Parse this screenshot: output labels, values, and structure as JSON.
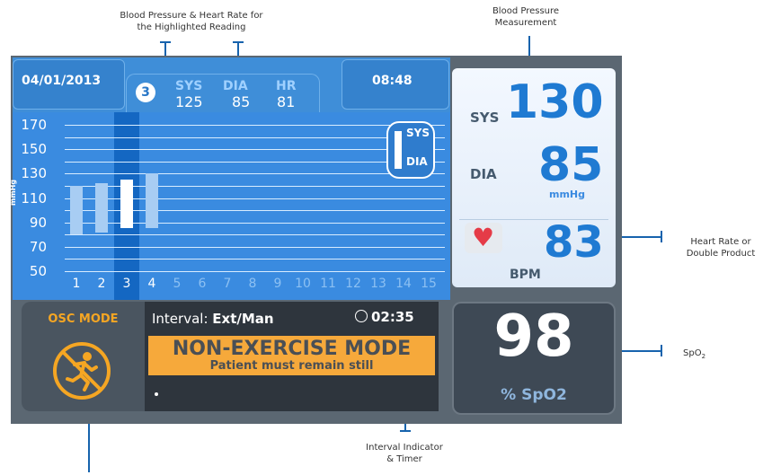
{
  "annotations": {
    "top_left_line1": "Blood Pressure & Heart Rate for",
    "top_left_line2": "the Highlighted Reading",
    "top_right_line1": "Blood Pressure",
    "top_right_line2": "Measurement",
    "right_hr_line1": "Heart Rate or",
    "right_hr_line2": "Double Product",
    "right_spo2": "SpO",
    "right_spo2_sub": "2",
    "bottom_interval_line1": "Interval Indicator",
    "bottom_interval_line2": "& Timer"
  },
  "header": {
    "date": "04/01/2013",
    "reading_number": "3",
    "sys_label": "SYS",
    "sys_value": "125",
    "dia_label": "DIA",
    "dia_value": "85",
    "hr_label": "HR",
    "hr_value": "81",
    "time": "08:48"
  },
  "chart": {
    "ylabel": "mmHg",
    "legend_sys": "SYS",
    "legend_dia": "DIA",
    "highlight_index": 3
  },
  "chart_data": {
    "type": "bar",
    "categories": [
      "1",
      "2",
      "3",
      "4",
      "5",
      "6",
      "7",
      "8",
      "9",
      "10",
      "11",
      "12",
      "13",
      "14",
      "15"
    ],
    "ticks": [
      50,
      70,
      90,
      110,
      130,
      150,
      170
    ],
    "ylim": [
      50,
      170
    ],
    "ylabel": "mmHg",
    "series": [
      {
        "name": "SYS",
        "values": [
          120,
          122,
          125,
          130,
          null,
          null,
          null,
          null,
          null,
          null,
          null,
          null,
          null,
          null,
          null
        ]
      },
      {
        "name": "DIA",
        "values": [
          80,
          82,
          85,
          85,
          null,
          null,
          null,
          null,
          null,
          null,
          null,
          null,
          null,
          null,
          null
        ]
      }
    ],
    "colors": {
      "bar": "#a8cdf3",
      "highlight_bar": "#ffffff",
      "highlight_column": "#1467c2"
    }
  },
  "bp": {
    "sys_label": "SYS",
    "sys_value": "130",
    "dia_label": "DIA",
    "dia_value": "85",
    "unit": "mmHg",
    "hr_value": "83",
    "hr_unit": "BPM",
    "heart_icon": "heart-icon"
  },
  "spo2": {
    "value": "98",
    "label": "% SpO2"
  },
  "osc": {
    "label": "OSC MODE",
    "icon": "no-running-icon"
  },
  "interval": {
    "label_prefix": "Interval: ",
    "label_value": "Ext/Man",
    "timer": "02:35",
    "timer_icon": "clock-icon",
    "mode_title": "NON-EXERCISE MODE",
    "mode_subtitle": "Patient must remain still"
  },
  "colors": {
    "accent_blue": "#1f7ad2",
    "annotation_blue": "#1763ad",
    "mode_orange": "#f6a93b",
    "osc_orange": "#f5a623"
  }
}
